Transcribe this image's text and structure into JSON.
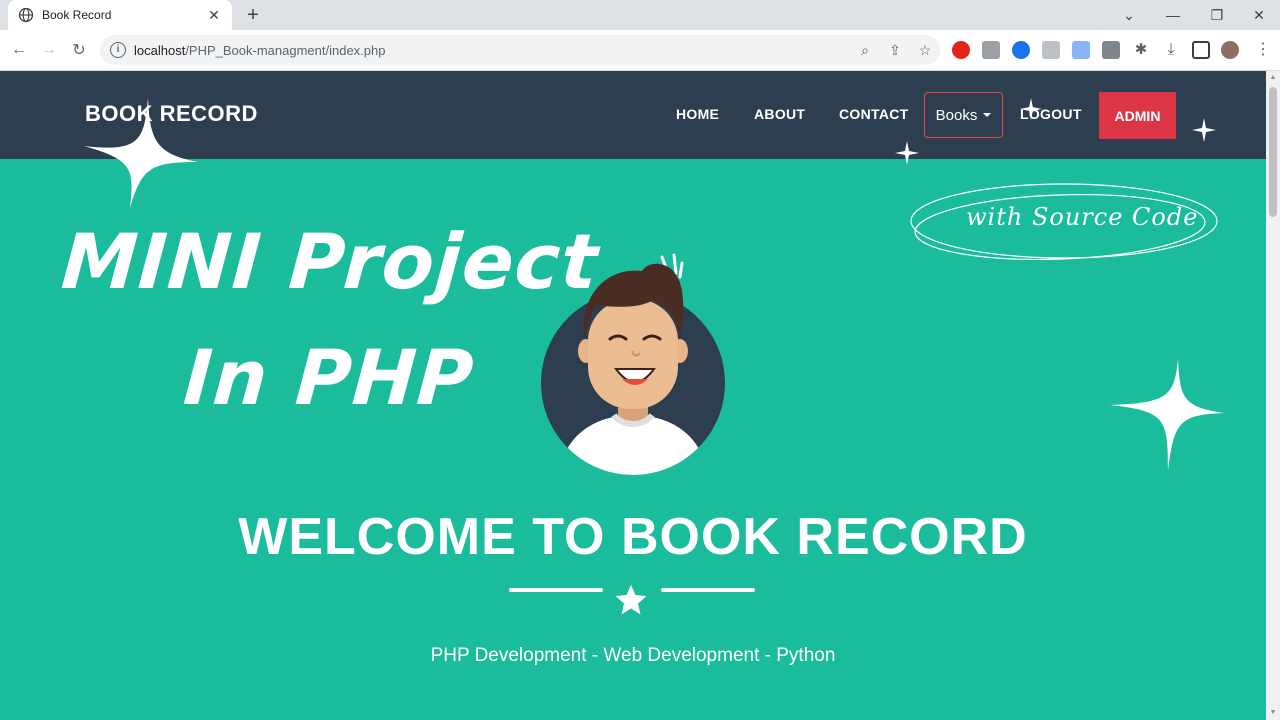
{
  "browser": {
    "tab_title": "Book Record",
    "url_host": "localhost",
    "url_path": "/PHP_Book-managment/index.php"
  },
  "navbar": {
    "brand": "BOOK RECORD",
    "links": [
      "HOME",
      "ABOUT",
      "CONTACT"
    ],
    "books_dropdown": "Books",
    "logout": "LOGOUT",
    "admin": "ADMIN"
  },
  "hero": {
    "title_line1": "MINI Project",
    "title_line2": "In PHP",
    "badge": "with Source Code",
    "welcome": "WELCOME TO BOOK RECORD",
    "subtitle": "PHP Development - Web Development - Python"
  },
  "colors": {
    "navbar": "#2c3e50",
    "page_bg": "#1abc9c",
    "admin_btn": "#dc3545"
  }
}
